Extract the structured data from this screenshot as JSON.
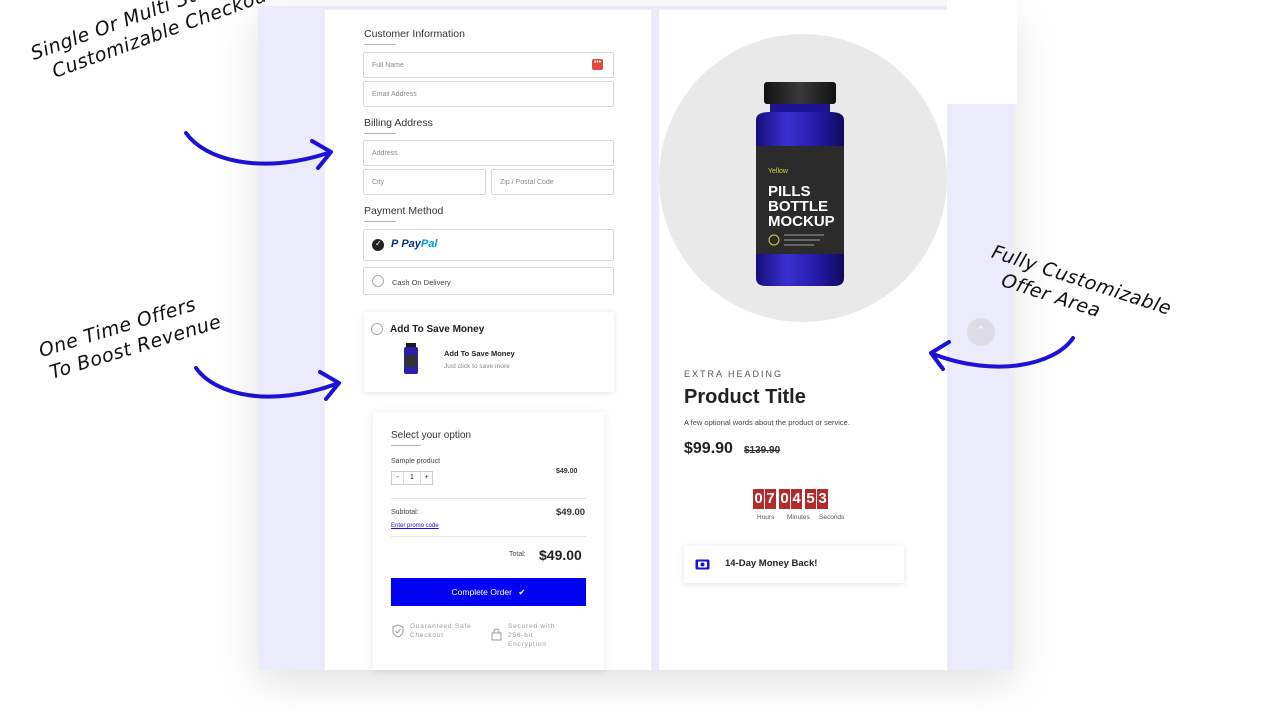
{
  "annotations": {
    "checkout_line1": "Single Or Multi Steps &",
    "checkout_line2": "Customizable Checkout",
    "offers_line1": "One Time Offers",
    "offers_line2": "To Boost Revenue",
    "offer_area_line1": "Fully Customizable",
    "offer_area_line2": "Offer Area"
  },
  "customer": {
    "title": "Customer Information",
    "full_name_placeholder": "Full Name",
    "email_placeholder": "Email Address",
    "badge": "•••"
  },
  "billing": {
    "title": "Billing Address",
    "address_placeholder": "Address",
    "city_placeholder": "City",
    "zip_placeholder": "Zip / Postal Code"
  },
  "payment": {
    "title": "Payment Method",
    "paypal_p": "P",
    "paypal_label_dark": "Pay",
    "paypal_label_light": "Pal",
    "cod_label": "Cash On Delivery"
  },
  "offer": {
    "heading": "Add To Save Money",
    "item_title": "Add To Save Money",
    "item_subtitle": "Just click to save more"
  },
  "order": {
    "title": "Select your option",
    "product_name": "Sample product",
    "product_price": "$49.00",
    "qty_minus": "-",
    "qty_value": "1",
    "qty_plus": "+",
    "subtotal_label": "Subtotal:",
    "subtotal_value": "$49.00",
    "promo_link": "Enter promo code",
    "total_label": "Total:",
    "total_value": "$49.00",
    "complete_button": "Complete Order",
    "guarantee_text": "Guaranteed Safe Checkout",
    "secure_text": "Secured with 256-bit Encryption"
  },
  "product": {
    "bottle_brand": "Yellow",
    "bottle_line1": "PILLS",
    "bottle_line2": "BOTTLE",
    "bottle_line3": "MOCKUP",
    "extra_heading": "EXTRA HEADING",
    "title": "Product Title",
    "description": "A few optional words about the product or service.",
    "price": "$99.90",
    "old_price": "$139.90"
  },
  "timer": {
    "hours": [
      "0",
      "7"
    ],
    "minutes": [
      "0",
      "4"
    ],
    "seconds": [
      "5",
      "3"
    ],
    "hours_label": "Hours",
    "minutes_label": "Minutes",
    "seconds_label": "Seconds"
  },
  "guarantee": {
    "label": "14-Day Money Back!"
  },
  "colors": {
    "accent": "#0000f3",
    "timer": "#b22a2a",
    "frame": "#ecebfb",
    "arrow": "#1b12d6"
  }
}
